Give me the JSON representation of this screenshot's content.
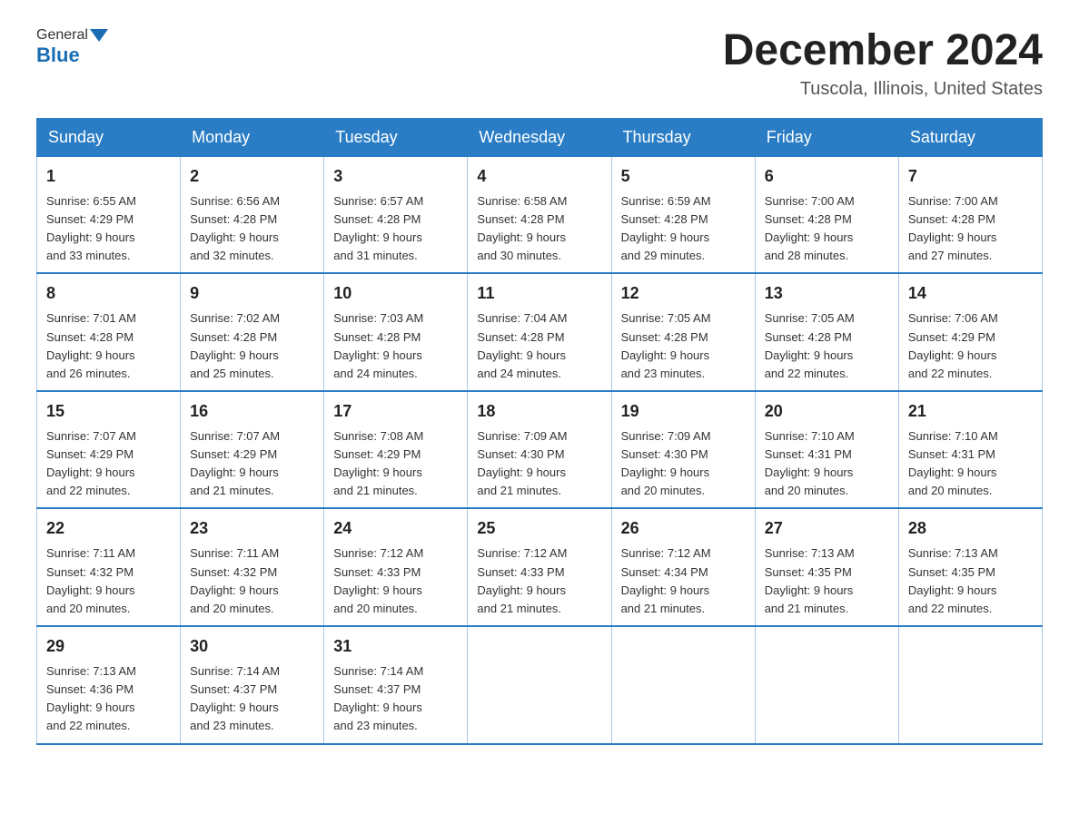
{
  "header": {
    "logo": {
      "general": "General",
      "blue": "Blue"
    },
    "title": "December 2024",
    "location": "Tuscola, Illinois, United States"
  },
  "days_of_week": [
    "Sunday",
    "Monday",
    "Tuesday",
    "Wednesday",
    "Thursday",
    "Friday",
    "Saturday"
  ],
  "weeks": [
    [
      {
        "day": "1",
        "sunrise": "Sunrise: 6:55 AM",
        "sunset": "Sunset: 4:29 PM",
        "daylight": "Daylight: 9 hours",
        "daylight2": "and 33 minutes."
      },
      {
        "day": "2",
        "sunrise": "Sunrise: 6:56 AM",
        "sunset": "Sunset: 4:28 PM",
        "daylight": "Daylight: 9 hours",
        "daylight2": "and 32 minutes."
      },
      {
        "day": "3",
        "sunrise": "Sunrise: 6:57 AM",
        "sunset": "Sunset: 4:28 PM",
        "daylight": "Daylight: 9 hours",
        "daylight2": "and 31 minutes."
      },
      {
        "day": "4",
        "sunrise": "Sunrise: 6:58 AM",
        "sunset": "Sunset: 4:28 PM",
        "daylight": "Daylight: 9 hours",
        "daylight2": "and 30 minutes."
      },
      {
        "day": "5",
        "sunrise": "Sunrise: 6:59 AM",
        "sunset": "Sunset: 4:28 PM",
        "daylight": "Daylight: 9 hours",
        "daylight2": "and 29 minutes."
      },
      {
        "day": "6",
        "sunrise": "Sunrise: 7:00 AM",
        "sunset": "Sunset: 4:28 PM",
        "daylight": "Daylight: 9 hours",
        "daylight2": "and 28 minutes."
      },
      {
        "day": "7",
        "sunrise": "Sunrise: 7:00 AM",
        "sunset": "Sunset: 4:28 PM",
        "daylight": "Daylight: 9 hours",
        "daylight2": "and 27 minutes."
      }
    ],
    [
      {
        "day": "8",
        "sunrise": "Sunrise: 7:01 AM",
        "sunset": "Sunset: 4:28 PM",
        "daylight": "Daylight: 9 hours",
        "daylight2": "and 26 minutes."
      },
      {
        "day": "9",
        "sunrise": "Sunrise: 7:02 AM",
        "sunset": "Sunset: 4:28 PM",
        "daylight": "Daylight: 9 hours",
        "daylight2": "and 25 minutes."
      },
      {
        "day": "10",
        "sunrise": "Sunrise: 7:03 AM",
        "sunset": "Sunset: 4:28 PM",
        "daylight": "Daylight: 9 hours",
        "daylight2": "and 24 minutes."
      },
      {
        "day": "11",
        "sunrise": "Sunrise: 7:04 AM",
        "sunset": "Sunset: 4:28 PM",
        "daylight": "Daylight: 9 hours",
        "daylight2": "and 24 minutes."
      },
      {
        "day": "12",
        "sunrise": "Sunrise: 7:05 AM",
        "sunset": "Sunset: 4:28 PM",
        "daylight": "Daylight: 9 hours",
        "daylight2": "and 23 minutes."
      },
      {
        "day": "13",
        "sunrise": "Sunrise: 7:05 AM",
        "sunset": "Sunset: 4:28 PM",
        "daylight": "Daylight: 9 hours",
        "daylight2": "and 22 minutes."
      },
      {
        "day": "14",
        "sunrise": "Sunrise: 7:06 AM",
        "sunset": "Sunset: 4:29 PM",
        "daylight": "Daylight: 9 hours",
        "daylight2": "and 22 minutes."
      }
    ],
    [
      {
        "day": "15",
        "sunrise": "Sunrise: 7:07 AM",
        "sunset": "Sunset: 4:29 PM",
        "daylight": "Daylight: 9 hours",
        "daylight2": "and 22 minutes."
      },
      {
        "day": "16",
        "sunrise": "Sunrise: 7:07 AM",
        "sunset": "Sunset: 4:29 PM",
        "daylight": "Daylight: 9 hours",
        "daylight2": "and 21 minutes."
      },
      {
        "day": "17",
        "sunrise": "Sunrise: 7:08 AM",
        "sunset": "Sunset: 4:29 PM",
        "daylight": "Daylight: 9 hours",
        "daylight2": "and 21 minutes."
      },
      {
        "day": "18",
        "sunrise": "Sunrise: 7:09 AM",
        "sunset": "Sunset: 4:30 PM",
        "daylight": "Daylight: 9 hours",
        "daylight2": "and 21 minutes."
      },
      {
        "day": "19",
        "sunrise": "Sunrise: 7:09 AM",
        "sunset": "Sunset: 4:30 PM",
        "daylight": "Daylight: 9 hours",
        "daylight2": "and 20 minutes."
      },
      {
        "day": "20",
        "sunrise": "Sunrise: 7:10 AM",
        "sunset": "Sunset: 4:31 PM",
        "daylight": "Daylight: 9 hours",
        "daylight2": "and 20 minutes."
      },
      {
        "day": "21",
        "sunrise": "Sunrise: 7:10 AM",
        "sunset": "Sunset: 4:31 PM",
        "daylight": "Daylight: 9 hours",
        "daylight2": "and 20 minutes."
      }
    ],
    [
      {
        "day": "22",
        "sunrise": "Sunrise: 7:11 AM",
        "sunset": "Sunset: 4:32 PM",
        "daylight": "Daylight: 9 hours",
        "daylight2": "and 20 minutes."
      },
      {
        "day": "23",
        "sunrise": "Sunrise: 7:11 AM",
        "sunset": "Sunset: 4:32 PM",
        "daylight": "Daylight: 9 hours",
        "daylight2": "and 20 minutes."
      },
      {
        "day": "24",
        "sunrise": "Sunrise: 7:12 AM",
        "sunset": "Sunset: 4:33 PM",
        "daylight": "Daylight: 9 hours",
        "daylight2": "and 20 minutes."
      },
      {
        "day": "25",
        "sunrise": "Sunrise: 7:12 AM",
        "sunset": "Sunset: 4:33 PM",
        "daylight": "Daylight: 9 hours",
        "daylight2": "and 21 minutes."
      },
      {
        "day": "26",
        "sunrise": "Sunrise: 7:12 AM",
        "sunset": "Sunset: 4:34 PM",
        "daylight": "Daylight: 9 hours",
        "daylight2": "and 21 minutes."
      },
      {
        "day": "27",
        "sunrise": "Sunrise: 7:13 AM",
        "sunset": "Sunset: 4:35 PM",
        "daylight": "Daylight: 9 hours",
        "daylight2": "and 21 minutes."
      },
      {
        "day": "28",
        "sunrise": "Sunrise: 7:13 AM",
        "sunset": "Sunset: 4:35 PM",
        "daylight": "Daylight: 9 hours",
        "daylight2": "and 22 minutes."
      }
    ],
    [
      {
        "day": "29",
        "sunrise": "Sunrise: 7:13 AM",
        "sunset": "Sunset: 4:36 PM",
        "daylight": "Daylight: 9 hours",
        "daylight2": "and 22 minutes."
      },
      {
        "day": "30",
        "sunrise": "Sunrise: 7:14 AM",
        "sunset": "Sunset: 4:37 PM",
        "daylight": "Daylight: 9 hours",
        "daylight2": "and 23 minutes."
      },
      {
        "day": "31",
        "sunrise": "Sunrise: 7:14 AM",
        "sunset": "Sunset: 4:37 PM",
        "daylight": "Daylight: 9 hours",
        "daylight2": "and 23 minutes."
      },
      null,
      null,
      null,
      null
    ]
  ]
}
